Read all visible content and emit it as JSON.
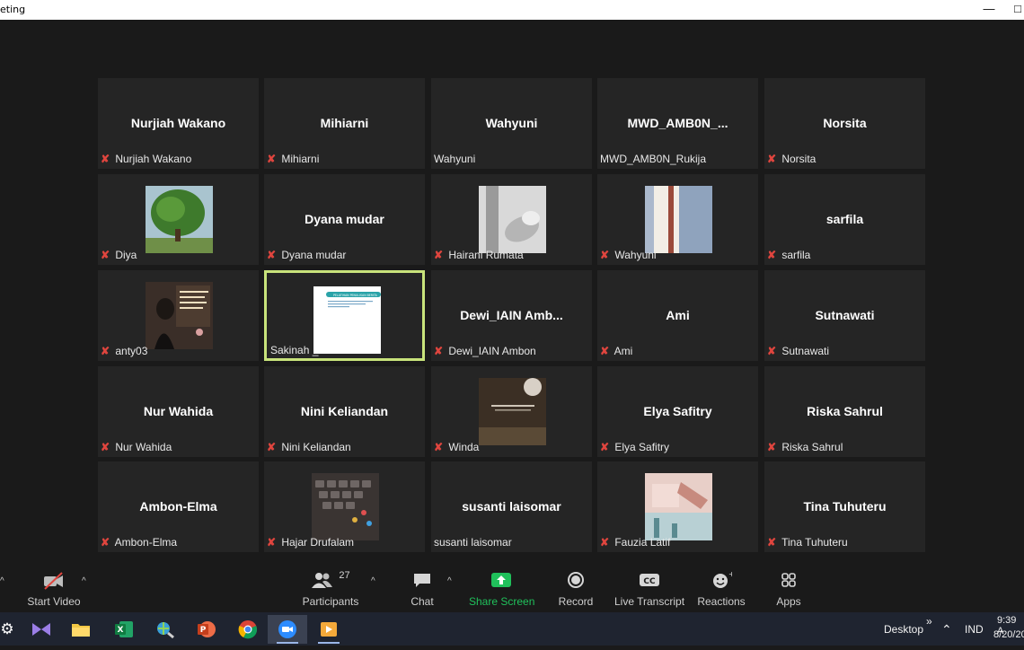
{
  "window": {
    "title": "eting",
    "minimize_icon": "minimize-icon"
  },
  "participants": [
    {
      "name": "Nurjiah Wakano",
      "caption": "Nurjiah Wakano",
      "muted": true,
      "display": "name"
    },
    {
      "name": "Mihiarni",
      "caption": "Mihiarni",
      "muted": true,
      "display": "name"
    },
    {
      "name": "Wahyuni",
      "caption": "Wahyuni",
      "muted": false,
      "display": "name"
    },
    {
      "name": "MWD_AMB0N_...",
      "caption": "MWD_AMB0N_Rukija",
      "muted": false,
      "display": "name"
    },
    {
      "name": "Norsita",
      "caption": "Norsita",
      "muted": true,
      "display": "name"
    },
    {
      "name": "",
      "caption": "Diya",
      "muted": true,
      "display": "photo-tree"
    },
    {
      "name": "Dyana mudar",
      "caption": "Dyana mudar",
      "muted": true,
      "display": "name"
    },
    {
      "name": "",
      "caption": "Hairani Rumata",
      "muted": true,
      "display": "photo-hand"
    },
    {
      "name": "",
      "caption": "Wahyuni",
      "muted": true,
      "display": "photo-book"
    },
    {
      "name": "sarfila",
      "caption": "sarfila",
      "muted": true,
      "display": "name"
    },
    {
      "name": "",
      "caption": "anty03",
      "muted": true,
      "display": "photo-girl"
    },
    {
      "name": "",
      "caption": "Sakinah _",
      "muted": false,
      "display": "photo-slide",
      "active_speaker": true
    },
    {
      "name": "Dewi_IAIN Amb...",
      "caption": "Dewi_IAIN Ambon",
      "muted": true,
      "display": "name"
    },
    {
      "name": "Ami",
      "caption": "Ami",
      "muted": true,
      "display": "name"
    },
    {
      "name": "Sutnawati",
      "caption": "Sutnawati",
      "muted": true,
      "display": "name"
    },
    {
      "name": "Nur Wahida",
      "caption": "Nur Wahida",
      "muted": true,
      "display": "name"
    },
    {
      "name": "Nini Keliandan",
      "caption": "Nini Keliandan",
      "muted": true,
      "display": "name"
    },
    {
      "name": "",
      "caption": "Winda",
      "muted": true,
      "display": "photo-dark"
    },
    {
      "name": "Elya Safitry",
      "caption": "Elya Safitry",
      "muted": true,
      "display": "name"
    },
    {
      "name": "Riska Sahrul",
      "caption": "Riska Sahrul",
      "muted": true,
      "display": "name"
    },
    {
      "name": "Ambon-Elma",
      "caption": "Ambon-Elma",
      "muted": true,
      "display": "name"
    },
    {
      "name": "",
      "caption": "Hajar Drufalam",
      "muted": true,
      "display": "photo-keyboard"
    },
    {
      "name": "susanti laisomar",
      "caption": "susanti laisomar",
      "muted": false,
      "display": "name"
    },
    {
      "name": "",
      "caption": "Fauzia Latif",
      "muted": true,
      "display": "photo-pink"
    },
    {
      "name": "Tina Tuhuteru",
      "caption": "Tina Tuhuteru",
      "muted": true,
      "display": "name"
    }
  ],
  "slide_thumb": {
    "heading": "PELATIHAN PENULISAN BERITA"
  },
  "toolbar": {
    "start_video": "Start Video",
    "participants": "Participants",
    "participant_count": "27",
    "chat": "Chat",
    "share_screen": "Share Screen",
    "record": "Record",
    "live_transcript": "Live Transcript",
    "reactions": "Reactions",
    "apps": "Apps"
  },
  "taskbar": {
    "desktop": "Desktop",
    "chevrons": "»",
    "language": "IND",
    "time": "9:39 A",
    "date": "8/20/20"
  },
  "colors": {
    "muted_red": "#e0453e",
    "share_green": "#20c05b",
    "active_border": "#c8e37b"
  }
}
